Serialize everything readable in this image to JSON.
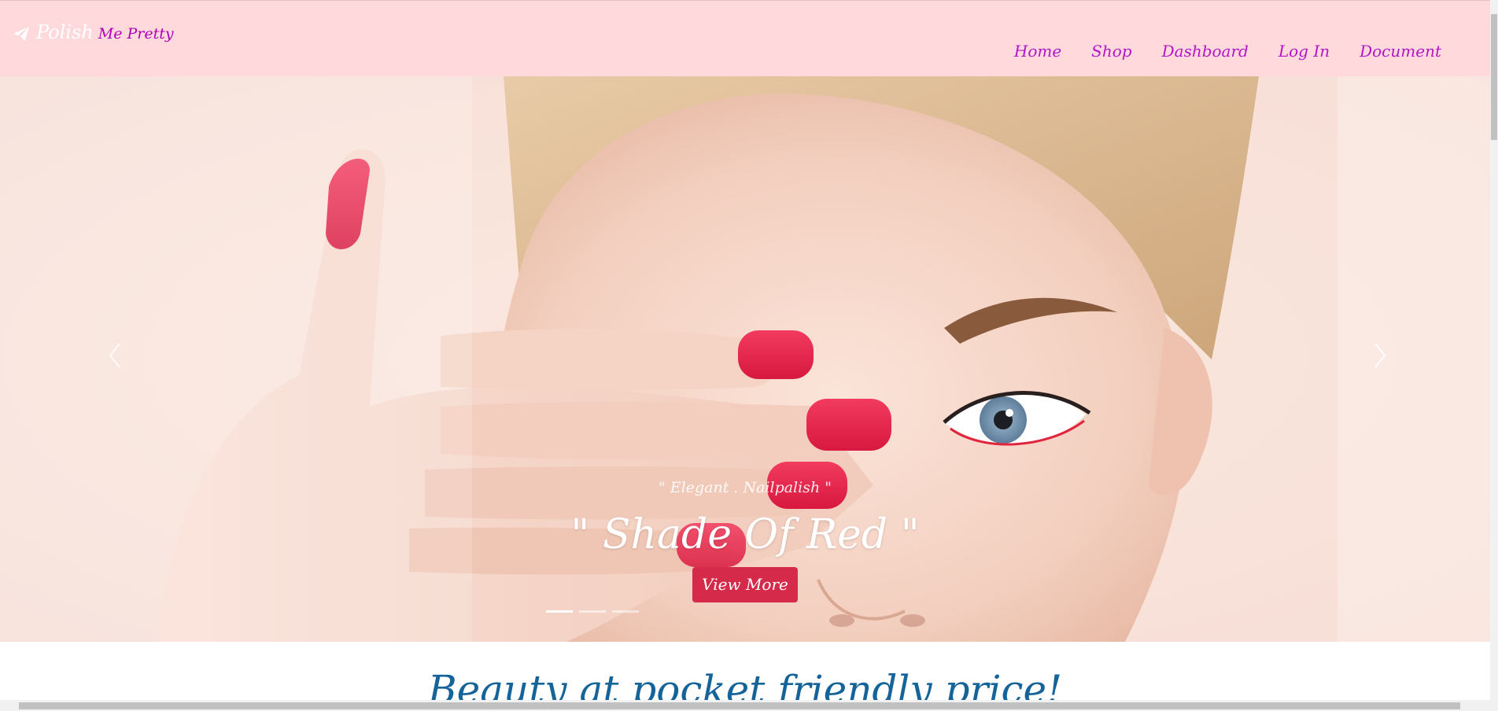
{
  "brand": {
    "main": "Polish",
    "sub": "Me Pretty",
    "icon": "paper-plane-icon"
  },
  "nav": {
    "items": [
      {
        "label": "Home"
      },
      {
        "label": "Shop"
      },
      {
        "label": "Dashboard"
      },
      {
        "label": "Log In"
      },
      {
        "label": "Document"
      }
    ]
  },
  "hero": {
    "subtitle": "\" Elegant . Nailpalish \"",
    "title": "\" Shade Of Red \"",
    "button_label": "View More",
    "slide_count": 3,
    "active_slide": 1
  },
  "section": {
    "heading": "Beauty at pocket friendly price!"
  },
  "colors": {
    "navbar_bg": "#ffd9dc",
    "nav_link": "#b414c8",
    "brand_sub": "#b000b8",
    "button_bg": "#d62a4b",
    "heading": "#14649a",
    "nail": "#e8224a"
  }
}
